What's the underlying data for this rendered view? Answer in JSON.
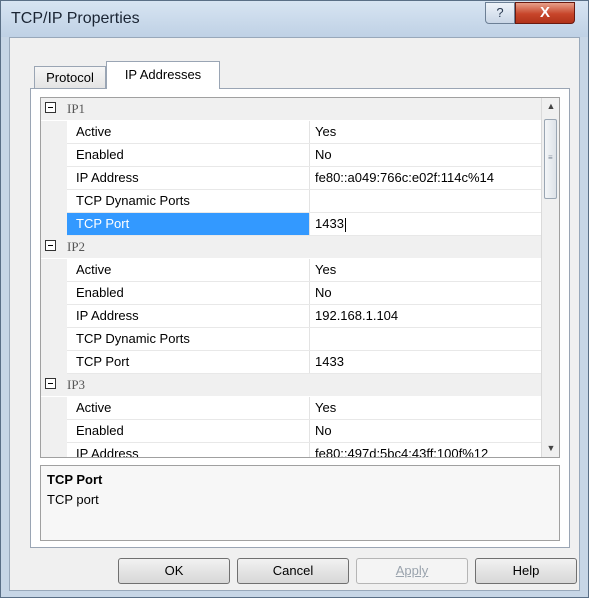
{
  "window": {
    "title": "TCP/IP Properties",
    "help_glyph": "?",
    "close_glyph": "X"
  },
  "tabs": [
    {
      "label": "Protocol"
    },
    {
      "label": "IP Addresses"
    }
  ],
  "grid": {
    "groups": [
      {
        "name": "IP1",
        "rows": [
          {
            "name": "Active",
            "value": "Yes"
          },
          {
            "name": "Enabled",
            "value": "No"
          },
          {
            "name": "IP Address",
            "value": "fe80::a049:766c:e02f:114c%14"
          },
          {
            "name": "TCP Dynamic Ports",
            "value": ""
          },
          {
            "name": "TCP Port",
            "value": "1433"
          }
        ]
      },
      {
        "name": "IP2",
        "rows": [
          {
            "name": "Active",
            "value": "Yes"
          },
          {
            "name": "Enabled",
            "value": "No"
          },
          {
            "name": "IP Address",
            "value": "192.168.1.104"
          },
          {
            "name": "TCP Dynamic Ports",
            "value": ""
          },
          {
            "name": "TCP Port",
            "value": "1433"
          }
        ]
      },
      {
        "name": "IP3",
        "rows": [
          {
            "name": "Active",
            "value": "Yes"
          },
          {
            "name": "Enabled",
            "value": "No"
          },
          {
            "name": "IP Address",
            "value": "fe80::497d:5bc4:43ff:100f%12"
          }
        ]
      }
    ],
    "scroll_up_glyph": "▲",
    "scroll_down_glyph": "▼"
  },
  "description": {
    "title": "TCP Port",
    "text": "TCP port"
  },
  "buttons": {
    "ok": "OK",
    "cancel": "Cancel",
    "apply": "Apply",
    "help": "Help"
  }
}
